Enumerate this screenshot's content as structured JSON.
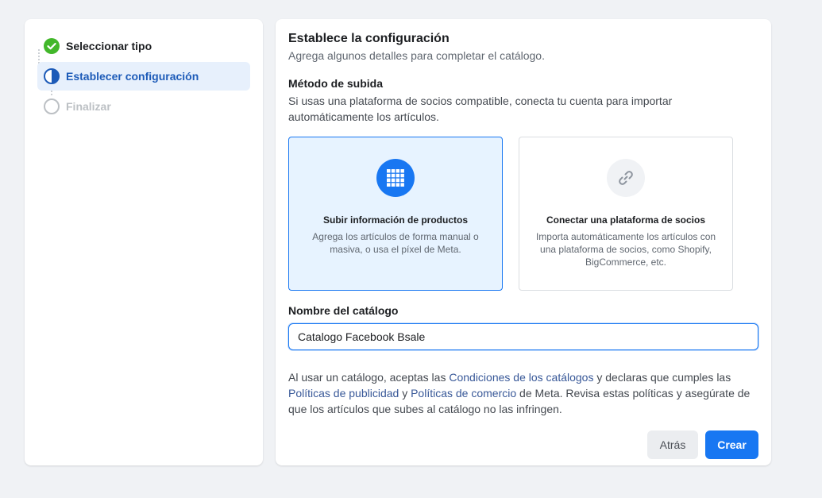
{
  "steps": [
    {
      "label": "Seleccionar tipo",
      "state": "done"
    },
    {
      "label": "Establecer configuración",
      "state": "active"
    },
    {
      "label": "Finalizar",
      "state": "pending"
    }
  ],
  "main": {
    "title": "Establece la configuración",
    "subtitle": "Agrega algunos detalles para completar el catálogo.",
    "upload_method": {
      "title": "Método de subida",
      "description": "Si usas una plataforma de socios compatible, conecta tu cuenta para importar automáticamente los artículos."
    },
    "options": [
      {
        "title": "Subir información de productos",
        "description": "Agrega los artículos de forma manual o masiva, o usa el píxel de Meta.",
        "icon": "grid-icon",
        "selected": true
      },
      {
        "title": "Conectar una plataforma de socios",
        "description": "Importa automáticamente los artículos con una plataforma de socios, como Shopify, BigCommerce, etc.",
        "icon": "link-icon",
        "selected": false
      }
    ],
    "catalog_name": {
      "label": "Nombre del catálogo",
      "value": "Catalogo Facebook Bsale"
    },
    "terms": {
      "part1": "Al usar un catálogo, aceptas las ",
      "link1": "Condiciones de los catálogos",
      "part2": " y declaras que cumples las ",
      "link2": "Políticas de publicidad",
      "part3": " y ",
      "link3": "Políticas de comercio",
      "part4": " de Meta. Revisa estas políticas y asegúrate de que los artículos que subes al catálogo no las infringen."
    },
    "buttons": {
      "back": "Atrás",
      "create": "Crear"
    }
  },
  "colors": {
    "accent": "#1877f2",
    "success": "#42b72a",
    "link": "#385898"
  }
}
